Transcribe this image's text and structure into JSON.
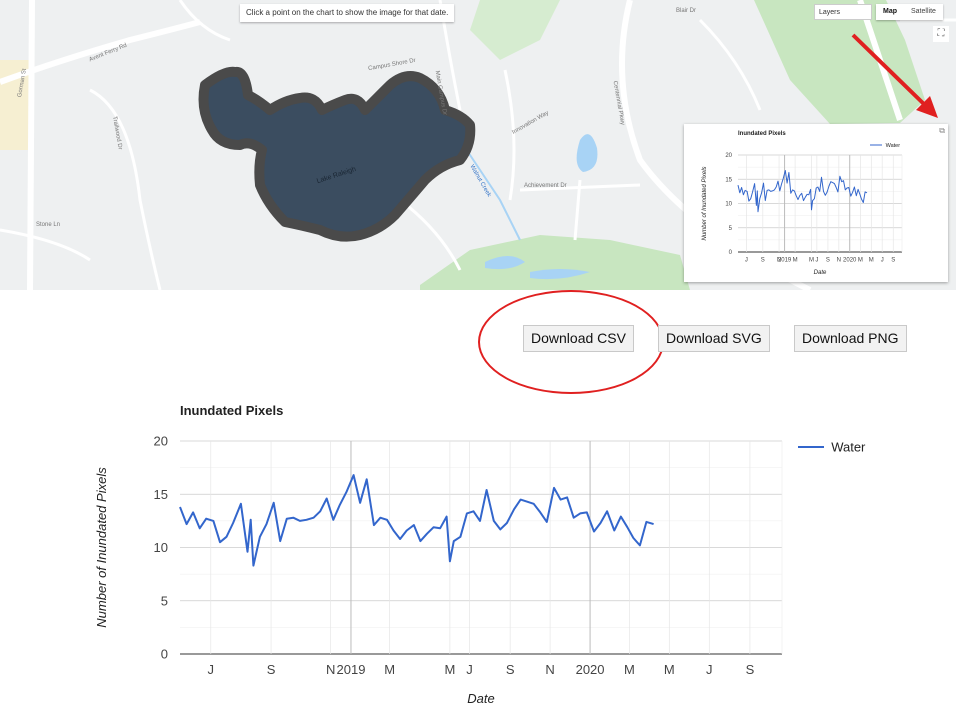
{
  "map": {
    "hint": "Click a point on the chart to show the image for that date.",
    "layers_label": "Layers",
    "map_type_options": [
      "Map",
      "Satellite"
    ],
    "map_type_selected": "Map",
    "fullscreen_icon": "fullscreen-icon",
    "popout_icon": "external-link-icon",
    "streets": [
      "Avent Ferry Rd",
      "Gorman St",
      "Lake Raleigh",
      "Walnut Creek",
      "Main Campus Dr",
      "Centennial Pkwy",
      "Achievement Dr",
      "Trailwood Dr",
      "Campus Shore Dr",
      "Blair Dr",
      "Innovation Way",
      "Stone Ln"
    ],
    "colors": {
      "lake_fill": "#3b4d60",
      "lake_outline": "#4a4a4a",
      "park_green": "#c8e6c0",
      "water_blue": "#a8d3f5",
      "annotation_red": "#e02020"
    }
  },
  "buttons": {
    "csv": "Download CSV",
    "svg": "Download SVG",
    "png": "Download PNG"
  },
  "chart_data": {
    "type": "line",
    "title": "Inundated Pixels",
    "xlabel": "Date",
    "ylabel": "Number of Inundated Pixels",
    "ylim": [
      0,
      20
    ],
    "yticks": [
      0,
      5,
      10,
      15,
      20
    ],
    "xlim": [
      "2018-04-15",
      "2020-10-20"
    ],
    "xticks": [
      {
        "date": "2018-06-01",
        "label": "J"
      },
      {
        "date": "2018-09-01",
        "label": "S"
      },
      {
        "date": "2018-12-01",
        "label": "N"
      },
      {
        "date": "2019-01-01",
        "label": "2019"
      },
      {
        "date": "2019-03-01",
        "label": "M"
      },
      {
        "date": "2019-06-01",
        "label": "M"
      },
      {
        "date": "2019-07-01",
        "label": "J"
      },
      {
        "date": "2019-09-01",
        "label": "S"
      },
      {
        "date": "2019-11-01",
        "label": "N"
      },
      {
        "date": "2020-01-01",
        "label": "2020"
      },
      {
        "date": "2020-03-01",
        "label": "M"
      },
      {
        "date": "2020-05-01",
        "label": "M"
      },
      {
        "date": "2020-07-01",
        "label": "J"
      },
      {
        "date": "2020-09-01",
        "label": "S"
      }
    ],
    "grid": true,
    "legend": "right",
    "series": [
      {
        "name": "Water",
        "color": "#3366cc",
        "points": [
          [
            "2018-04-15",
            13.8
          ],
          [
            "2018-04-25",
            12.2
          ],
          [
            "2018-05-05",
            13.3
          ],
          [
            "2018-05-15",
            11.8
          ],
          [
            "2018-05-25",
            12.7
          ],
          [
            "2018-06-05",
            12.5
          ],
          [
            "2018-06-15",
            10.5
          ],
          [
            "2018-06-25",
            11.0
          ],
          [
            "2018-07-05",
            12.3
          ],
          [
            "2018-07-17",
            14.1
          ],
          [
            "2018-07-27",
            9.6
          ],
          [
            "2018-08-01",
            12.6
          ],
          [
            "2018-08-05",
            8.3
          ],
          [
            "2018-08-15",
            11.0
          ],
          [
            "2018-08-25",
            12.2
          ],
          [
            "2018-09-05",
            14.2
          ],
          [
            "2018-09-15",
            10.6
          ],
          [
            "2018-09-25",
            12.7
          ],
          [
            "2018-10-05",
            12.8
          ],
          [
            "2018-10-15",
            12.5
          ],
          [
            "2018-10-25",
            12.6
          ],
          [
            "2018-11-05",
            12.8
          ],
          [
            "2018-11-15",
            13.4
          ],
          [
            "2018-11-25",
            14.6
          ],
          [
            "2018-12-05",
            12.6
          ],
          [
            "2018-12-15",
            14.0
          ],
          [
            "2018-12-25",
            15.2
          ],
          [
            "2019-01-05",
            16.8
          ],
          [
            "2019-01-15",
            14.2
          ],
          [
            "2019-01-25",
            16.4
          ],
          [
            "2019-02-05",
            12.1
          ],
          [
            "2019-02-15",
            12.8
          ],
          [
            "2019-02-25",
            12.6
          ],
          [
            "2019-03-07",
            11.6
          ],
          [
            "2019-03-17",
            10.8
          ],
          [
            "2019-03-27",
            11.6
          ],
          [
            "2019-04-07",
            12.1
          ],
          [
            "2019-04-17",
            10.6
          ],
          [
            "2019-04-27",
            11.3
          ],
          [
            "2019-05-07",
            11.9
          ],
          [
            "2019-05-17",
            11.8
          ],
          [
            "2019-05-27",
            12.9
          ],
          [
            "2019-06-01",
            8.7
          ],
          [
            "2019-06-07",
            10.6
          ],
          [
            "2019-06-17",
            11.0
          ],
          [
            "2019-06-27",
            13.2
          ],
          [
            "2019-07-07",
            13.4
          ],
          [
            "2019-07-17",
            12.5
          ],
          [
            "2019-07-27",
            15.4
          ],
          [
            "2019-08-07",
            12.5
          ],
          [
            "2019-08-17",
            11.7
          ],
          [
            "2019-08-27",
            12.3
          ],
          [
            "2019-09-07",
            13.6
          ],
          [
            "2019-09-17",
            14.5
          ],
          [
            "2019-09-27",
            14.3
          ],
          [
            "2019-10-07",
            14.1
          ],
          [
            "2019-10-17",
            13.3
          ],
          [
            "2019-10-27",
            12.4
          ],
          [
            "2019-11-07",
            15.6
          ],
          [
            "2019-11-17",
            14.5
          ],
          [
            "2019-11-27",
            14.7
          ],
          [
            "2019-12-07",
            12.8
          ],
          [
            "2019-12-17",
            13.2
          ],
          [
            "2019-12-27",
            13.3
          ],
          [
            "2020-01-07",
            11.5
          ],
          [
            "2020-01-17",
            12.3
          ],
          [
            "2020-01-27",
            13.4
          ],
          [
            "2020-02-07",
            11.6
          ],
          [
            "2020-02-17",
            12.9
          ],
          [
            "2020-02-27",
            11.9
          ],
          [
            "2020-03-07",
            10.9
          ],
          [
            "2020-03-17",
            10.2
          ],
          [
            "2020-03-27",
            12.4
          ],
          [
            "2020-04-07",
            12.2
          ]
        ]
      }
    ]
  }
}
